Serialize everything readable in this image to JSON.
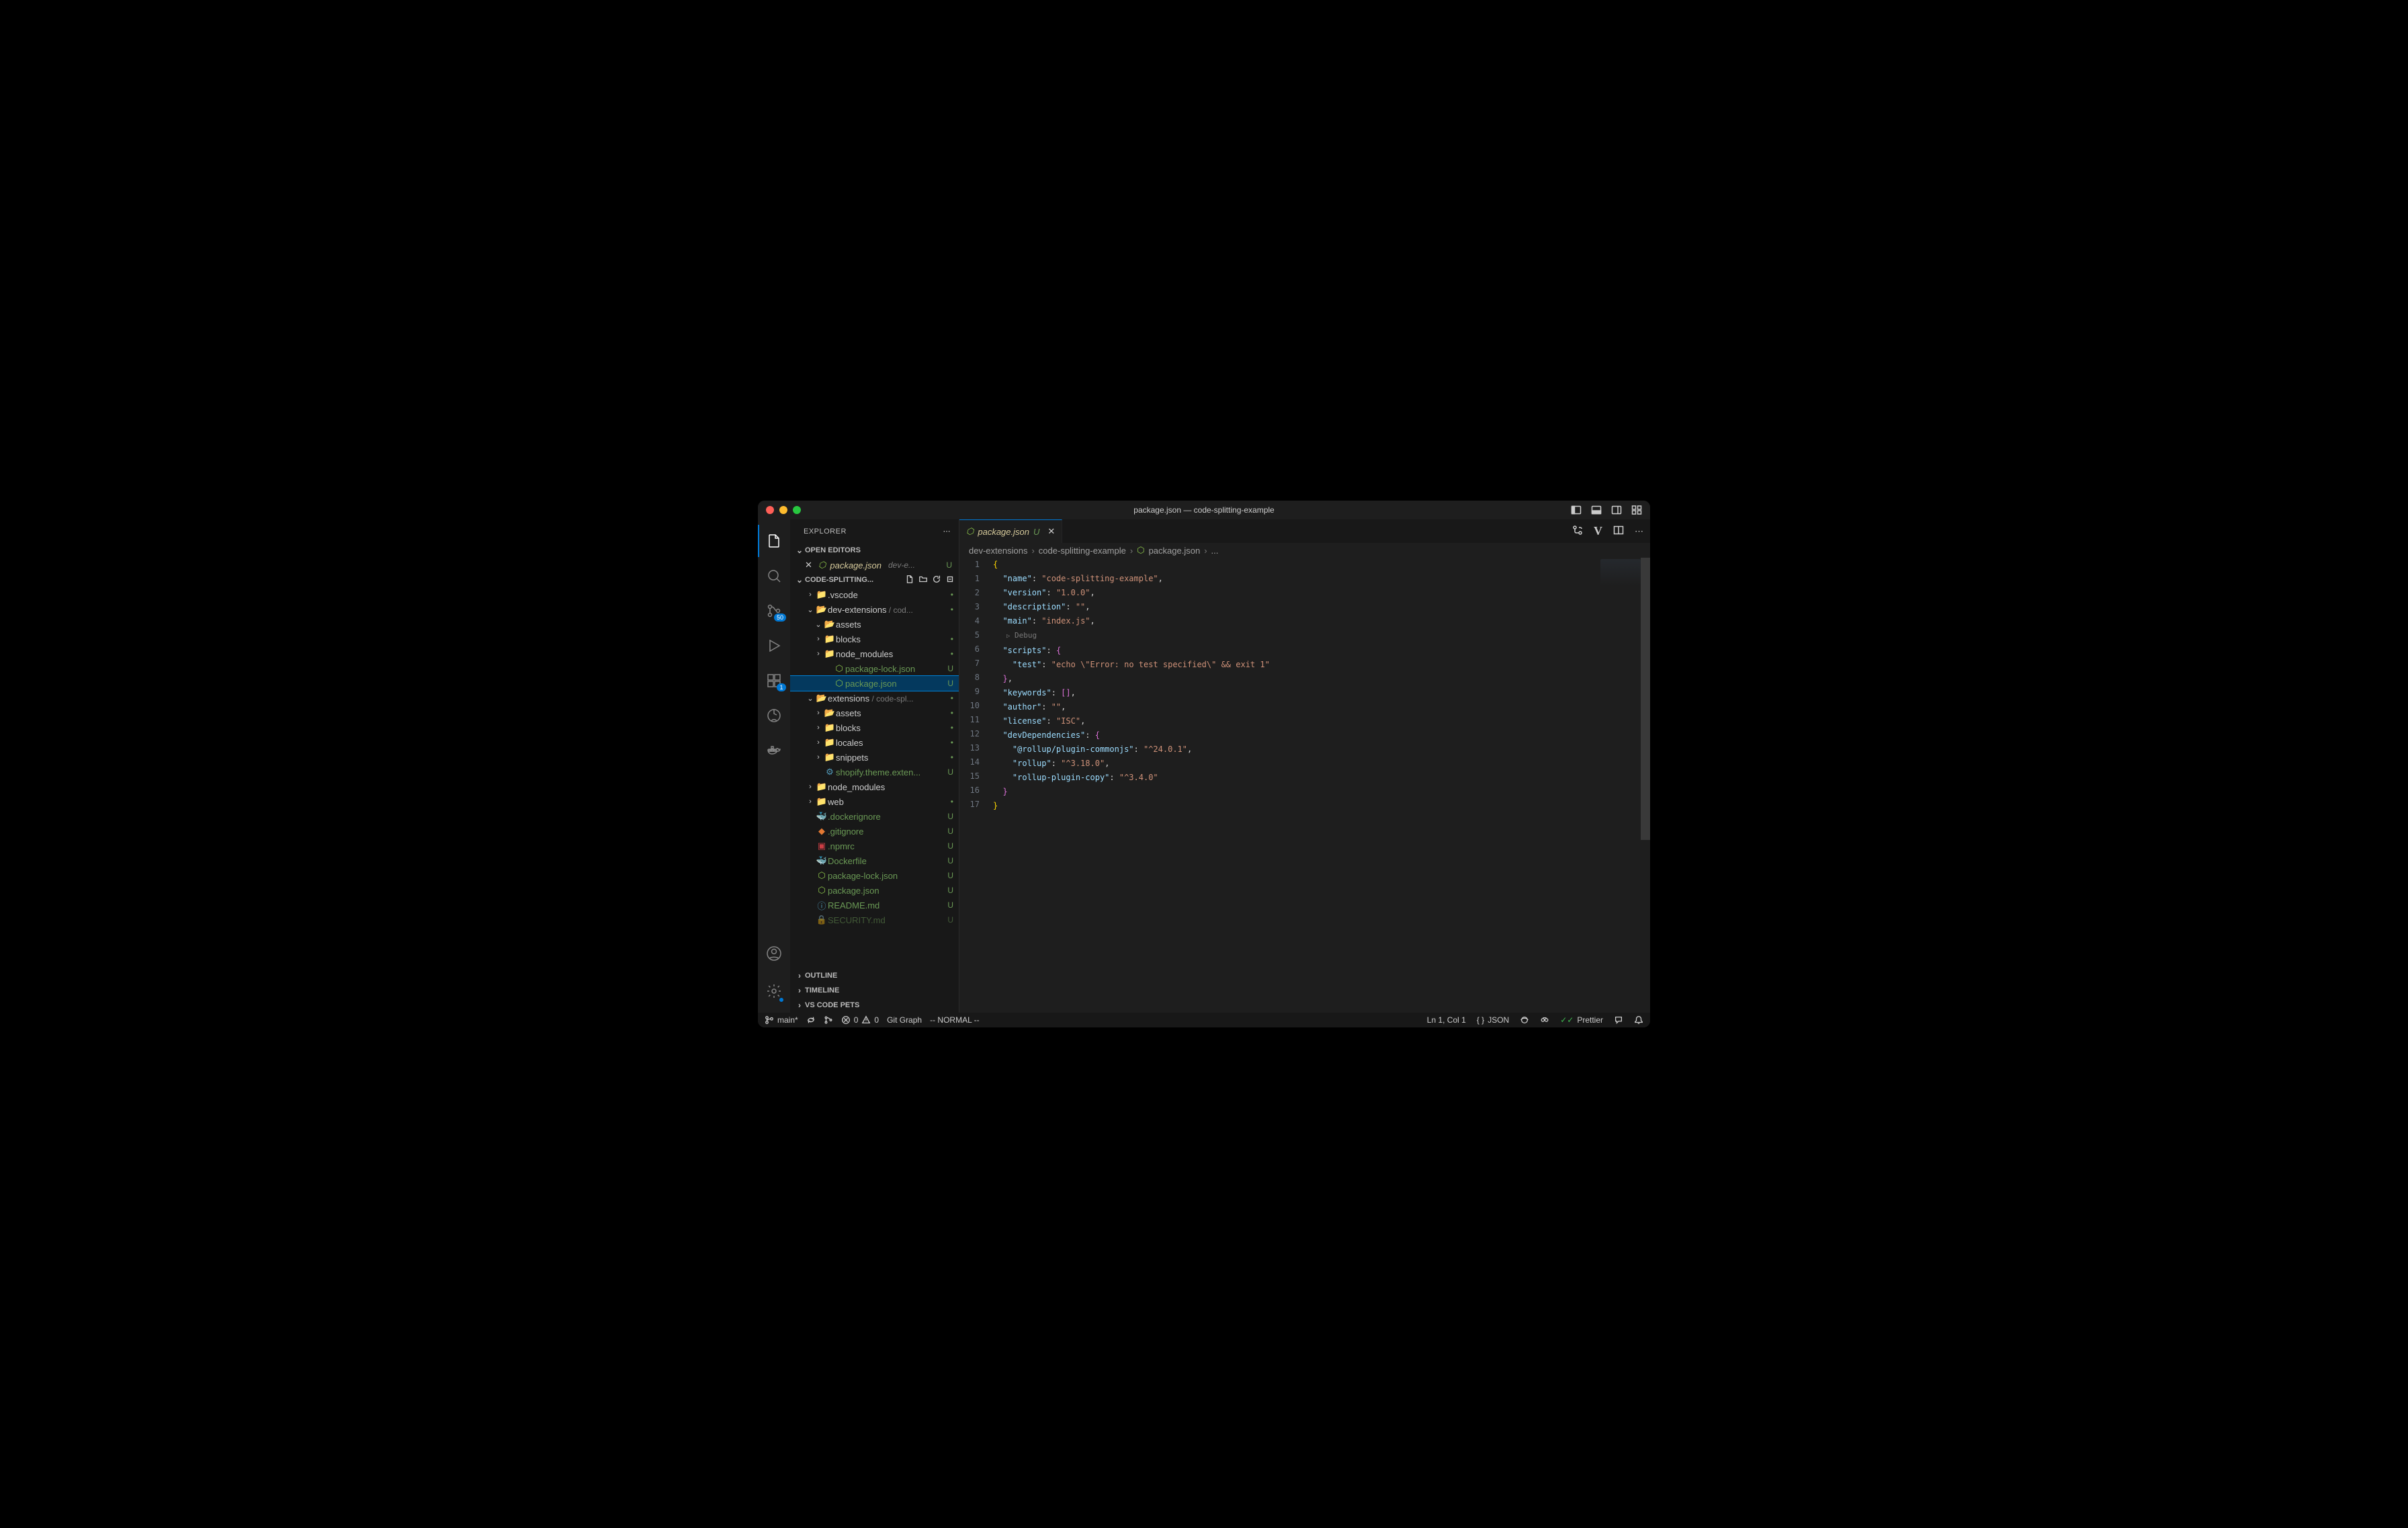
{
  "window_title": "package.json — code-splitting-example",
  "activity": {
    "scm_badge": "50",
    "ext_badge": "1"
  },
  "explorer": {
    "title": "EXPLORER",
    "open_editors_label": "OPEN EDITORS",
    "open_editor": {
      "name": "package.json",
      "suffix": "dev-e...",
      "status": "U"
    },
    "workspace_label": "CODE-SPLITTING...",
    "outline_label": "OUTLINE",
    "timeline_label": "TIMELINE",
    "pets_label": "VS CODE PETS"
  },
  "tree": [
    {
      "depth": 1,
      "chev": ">",
      "icon": "folder-vscode",
      "color": "fi-blue",
      "label": ".vscode",
      "status": "•",
      "statusCls": "dot"
    },
    {
      "depth": 1,
      "chev": "v",
      "icon": "folder",
      "color": "fi-yellow",
      "label": "dev-extensions",
      "dim": " / cod...",
      "status": "•",
      "statusCls": "dot"
    },
    {
      "depth": 2,
      "chev": "v",
      "icon": "folder",
      "color": "fi-yellow",
      "label": "assets"
    },
    {
      "depth": 2,
      "chev": ">",
      "icon": "folder-closed",
      "color": "fi-gray",
      "label": "blocks",
      "status": "•",
      "statusCls": "dot"
    },
    {
      "depth": 2,
      "chev": ">",
      "icon": "folder-node",
      "color": "fi-green",
      "label": "node_modules",
      "status": "•",
      "statusCls": "dot"
    },
    {
      "depth": 3,
      "icon": "json",
      "color": "node-green",
      "label": "package-lock.json",
      "gitU": true,
      "status": "U",
      "statusCls": "u"
    },
    {
      "depth": 3,
      "icon": "json",
      "color": "node-green",
      "label": "package.json",
      "gitU": true,
      "status": "U",
      "statusCls": "u",
      "selected": true
    },
    {
      "depth": 1,
      "chev": "v",
      "icon": "folder",
      "color": "fi-yellow",
      "label": "extensions",
      "dim": " / code-spl...",
      "status": "•",
      "statusCls": "dot"
    },
    {
      "depth": 2,
      "chev": ">",
      "icon": "folder",
      "color": "fi-yellow",
      "label": "assets",
      "status": "•",
      "statusCls": "dot"
    },
    {
      "depth": 2,
      "chev": ">",
      "icon": "folder-closed",
      "color": "fi-gray",
      "label": "blocks",
      "status": "•",
      "statusCls": "dot"
    },
    {
      "depth": 2,
      "chev": ">",
      "icon": "folder-locale",
      "color": "fi-purple",
      "label": "locales",
      "status": "•",
      "statusCls": "dot"
    },
    {
      "depth": 2,
      "chev": ">",
      "icon": "folder-closed",
      "color": "fi-gray",
      "label": "snippets",
      "status": "•",
      "statusCls": "dot"
    },
    {
      "depth": 2,
      "icon": "gear",
      "color": "fi-blue",
      "label": "shopify.theme.exten...",
      "gitU": true,
      "status": "U",
      "statusCls": "u"
    },
    {
      "depth": 1,
      "chev": ">",
      "icon": "folder-node",
      "color": "fi-green",
      "label": "node_modules"
    },
    {
      "depth": 1,
      "chev": ">",
      "icon": "folder-web",
      "color": "fi-blue",
      "label": "web",
      "status": "•",
      "statusCls": "dot"
    },
    {
      "depth": 1,
      "icon": "docker",
      "color": "fi-blue",
      "label": ".dockerignore",
      "gitU": true,
      "status": "U",
      "statusCls": "u"
    },
    {
      "depth": 1,
      "icon": "git",
      "color": "fi-orange",
      "label": ".gitignore",
      "gitU": true,
      "status": "U",
      "statusCls": "u"
    },
    {
      "depth": 1,
      "icon": "npm",
      "color": "fi-red",
      "label": ".npmrc",
      "gitU": true,
      "status": "U",
      "statusCls": "u"
    },
    {
      "depth": 1,
      "icon": "docker",
      "color": "fi-blue",
      "label": "Dockerfile",
      "gitU": true,
      "status": "U",
      "statusCls": "u"
    },
    {
      "depth": 1,
      "icon": "json",
      "color": "node-green",
      "label": "package-lock.json",
      "gitU": true,
      "status": "U",
      "statusCls": "u"
    },
    {
      "depth": 1,
      "icon": "json",
      "color": "node-green",
      "label": "package.json",
      "gitU": true,
      "status": "U",
      "statusCls": "u"
    },
    {
      "depth": 1,
      "icon": "info",
      "color": "fi-blue",
      "label": "README.md",
      "gitU": true,
      "status": "U",
      "statusCls": "u"
    },
    {
      "depth": 1,
      "icon": "lock",
      "color": "fi-yellow",
      "label": "SECURITY.md",
      "gitU": true,
      "status": "U",
      "statusCls": "u",
      "faded": true
    }
  ],
  "tab": {
    "name": "package.json",
    "status": "U"
  },
  "breadcrumb": [
    "dev-extensions",
    "code-splitting-example",
    "package.json",
    "..."
  ],
  "code_lens": "Debug",
  "code_lines": [
    {
      "n": "1",
      "html": "<span class='tok-brace'>{</span>"
    },
    {
      "n": "1",
      "html": "  <span class='tok-key'>\"name\"</span><span class='tok-punc'>: </span><span class='tok-str'>\"code-splitting-example\"</span><span class='tok-punc'>,</span>"
    },
    {
      "n": "2",
      "html": "  <span class='tok-key'>\"version\"</span><span class='tok-punc'>: </span><span class='tok-str'>\"1.0.0\"</span><span class='tok-punc'>,</span>"
    },
    {
      "n": "3",
      "html": "  <span class='tok-key'>\"description\"</span><span class='tok-punc'>: </span><span class='tok-str'>\"\"</span><span class='tok-punc'>,</span>"
    },
    {
      "n": "4",
      "html": "  <span class='tok-key'>\"main\"</span><span class='tok-punc'>: </span><span class='tok-str'>\"index.js\"</span><span class='tok-punc'>,</span>"
    },
    {
      "n": "",
      "lens": true
    },
    {
      "n": "5",
      "html": "  <span class='tok-key'>\"scripts\"</span><span class='tok-punc'>: </span><span class='tok-brace2'>{</span>"
    },
    {
      "n": "6",
      "html": "    <span class='tok-key'>\"test\"</span><span class='tok-punc'>: </span><span class='tok-str'>\"echo \\\"Error: no test specified\\\" &amp;&amp; exit 1\"</span>"
    },
    {
      "n": "7",
      "html": "  <span class='tok-brace2'>}</span><span class='tok-punc'>,</span>"
    },
    {
      "n": "8",
      "html": "  <span class='tok-key'>\"keywords\"</span><span class='tok-punc'>: </span><span class='tok-brace2'>[]</span><span class='tok-punc'>,</span>"
    },
    {
      "n": "9",
      "html": "  <span class='tok-key'>\"author\"</span><span class='tok-punc'>: </span><span class='tok-str'>\"\"</span><span class='tok-punc'>,</span>"
    },
    {
      "n": "10",
      "html": "  <span class='tok-key'>\"license\"</span><span class='tok-punc'>: </span><span class='tok-str'>\"ISC\"</span><span class='tok-punc'>,</span>"
    },
    {
      "n": "11",
      "html": "  <span class='tok-key'>\"devDependencies\"</span><span class='tok-punc'>: </span><span class='tok-brace2'>{</span>"
    },
    {
      "n": "12",
      "html": "    <span class='tok-key'>\"@rollup/plugin-commonjs\"</span><span class='tok-punc'>: </span><span class='tok-str'>\"^24.0.1\"</span><span class='tok-punc'>,</span>"
    },
    {
      "n": "13",
      "html": "    <span class='tok-key'>\"rollup\"</span><span class='tok-punc'>: </span><span class='tok-str'>\"^3.18.0\"</span><span class='tok-punc'>,</span>"
    },
    {
      "n": "14",
      "html": "    <span class='tok-key'>\"rollup-plugin-copy\"</span><span class='tok-punc'>: </span><span class='tok-str'>\"^3.4.0\"</span>"
    },
    {
      "n": "15",
      "html": "  <span class='tok-brace2'>}</span>"
    },
    {
      "n": "16",
      "html": "<span class='tok-brace'>}</span>"
    },
    {
      "n": "17",
      "html": ""
    }
  ],
  "status": {
    "branch": "main*",
    "errors": "0",
    "warnings": "0",
    "git_graph": "Git Graph",
    "vim_mode": "-- NORMAL --",
    "cursor": "Ln 1, Col 1",
    "lang": "JSON",
    "prettier": "Prettier"
  }
}
